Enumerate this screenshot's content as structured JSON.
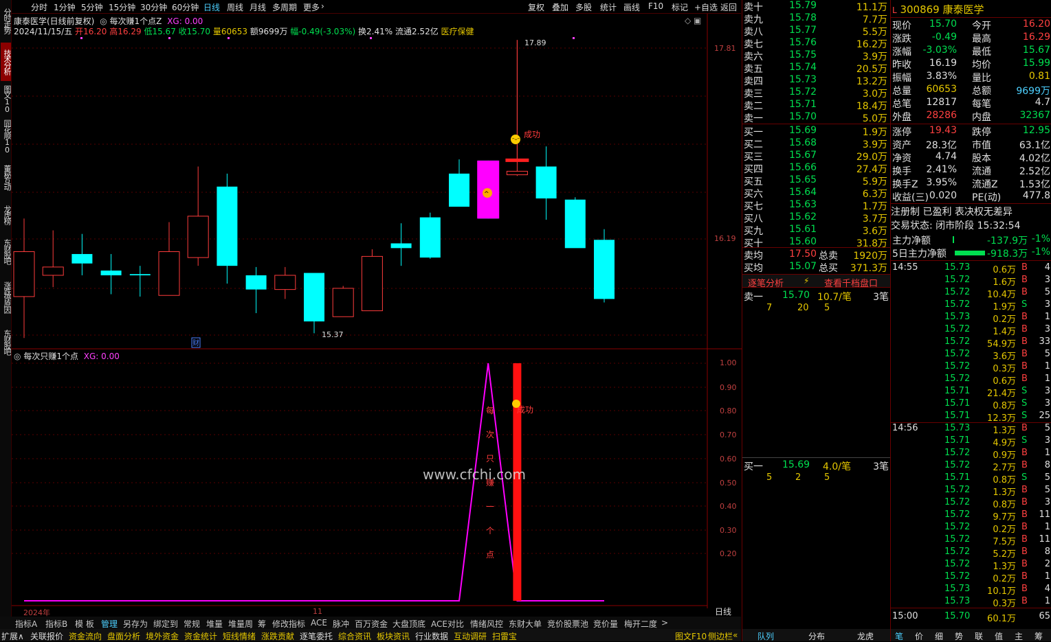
{
  "left_tabs": [
    "分时走势",
    "技术分析",
    "图文10",
    "同花顺10",
    "董秘互动",
    "龙虎榜",
    "东财股吧",
    "涨跌停原因",
    "东财股吧"
  ],
  "top_periods": [
    "分时",
    "1分钟",
    "5分钟",
    "15分钟",
    "30分钟",
    "60分钟",
    "日线",
    "周线",
    "月线",
    "多周期",
    "更多"
  ],
  "top_tools": [
    "复权",
    "叠加",
    "多股",
    "统计",
    "画线",
    "F10",
    "标记",
    "+自选",
    "返回"
  ],
  "chart_header": {
    "title": "康泰医学(日线前复权)",
    "indicator": "每次赚1个点Z",
    "xg": "XG: 0.00",
    "date": "2024/11/15/五",
    "open_l": "开",
    "open": "16.20",
    "high_l": "高",
    "high": "16.29",
    "low_l": "低",
    "low": "15.67",
    "close_l": "收",
    "close": "15.70",
    "vol_l": "量",
    "vol": "60653",
    "amt_l": "额",
    "amt": "9699万",
    "chg_l": "幅",
    "chg": "-0.49(-3.03%)",
    "turn_l": "换",
    "turn": "2.41%",
    "float_l": "流通",
    "float": "2.52亿",
    "sector": "医疗保健"
  },
  "main_chart": {
    "price_labels": [
      "17.81",
      "16.19"
    ],
    "high_marker": "17.89",
    "low_marker": "15.37",
    "success": "成功",
    "cai": "财"
  },
  "sub_header": {
    "name": "每次只赚1个点",
    "xg": "XG: 0.00"
  },
  "sub_axis": [
    "1.00",
    "0.90",
    "0.80",
    "0.70",
    "0.60",
    "0.50",
    "0.40",
    "0.30",
    "0.20"
  ],
  "sub_text": [
    "每",
    "次",
    "只",
    "赚",
    "一",
    "个",
    "点"
  ],
  "sub_success": "成功",
  "watermark": "www.cfchi.com",
  "x_labels": [
    "2024年",
    "11"
  ],
  "period_button": "日线",
  "zoom": [
    "+",
    "-",
    "◁",
    "▷"
  ],
  "chart_data": {
    "type": "candlestick",
    "ylim": [
      15.2,
      18.0
    ],
    "candles": [
      {
        "o": 15.72,
        "h": 16.38,
        "l": 15.37,
        "c": 16.1
      },
      {
        "o": 15.9,
        "h": 16.28,
        "l": 15.8,
        "c": 15.97
      },
      {
        "o": 16.08,
        "h": 16.25,
        "l": 15.9,
        "c": 16.0
      },
      {
        "o": 15.94,
        "h": 16.08,
        "l": 15.74,
        "c": 15.9
      },
      {
        "o": 15.91,
        "h": 15.98,
        "l": 15.72,
        "c": 15.9
      },
      {
        "o": 15.73,
        "h": 16.35,
        "l": 15.75,
        "c": 16.1
      },
      {
        "o": 16.05,
        "h": 16.82,
        "l": 15.98,
        "c": 16.4
      },
      {
        "o": 16.65,
        "h": 16.76,
        "l": 15.83,
        "c": 15.98
      },
      {
        "o": 15.9,
        "h": 15.97,
        "l": 15.58,
        "c": 15.78
      },
      {
        "o": 15.78,
        "h": 15.97,
        "l": 15.7,
        "c": 15.9
      },
      {
        "o": 15.92,
        "h": 15.92,
        "l": 15.41,
        "c": 15.51
      },
      {
        "o": 15.55,
        "h": 15.81,
        "l": 15.57,
        "c": 15.79
      },
      {
        "o": 15.6,
        "h": 16.12,
        "l": 15.64,
        "c": 16.06
      },
      {
        "o": 16.17,
        "h": 16.34,
        "l": 15.98,
        "c": 16.13
      },
      {
        "o": 16.39,
        "h": 16.43,
        "l": 16.04,
        "c": 16.05
      },
      {
        "o": 16.76,
        "h": 16.88,
        "l": 16.49,
        "c": 16.48
      },
      {
        "o": 16.87,
        "h": 16.87,
        "l": 16.38,
        "c": 16.38
      },
      {
        "o": 16.75,
        "h": 17.89,
        "l": 16.74,
        "c": 16.78
      },
      {
        "o": 16.82,
        "h": 16.99,
        "l": 16.37,
        "c": 16.55
      },
      {
        "o": 16.54,
        "h": 16.56,
        "l": 16.23,
        "c": 16.13
      },
      {
        "o": 16.2,
        "h": 16.29,
        "l": 15.67,
        "c": 15.7
      }
    ],
    "signal": [
      0,
      0,
      0,
      0,
      0,
      0,
      0,
      0,
      0,
      0,
      0,
      0,
      0,
      0,
      0,
      0,
      1,
      0,
      0,
      0,
      0
    ],
    "signal_bar_index": 17
  },
  "stock": {
    "flag": "L",
    "code": "300869",
    "name": "康泰医学"
  },
  "orderbook": {
    "asks": [
      {
        "label": "卖十",
        "price": "15.79",
        "vol": "11.1万"
      },
      {
        "label": "卖九",
        "price": "15.78",
        "vol": "7.7万"
      },
      {
        "label": "卖八",
        "price": "15.77",
        "vol": "5.5万"
      },
      {
        "label": "卖七",
        "price": "15.76",
        "vol": "16.2万"
      },
      {
        "label": "卖六",
        "price": "15.75",
        "vol": "3.9万"
      },
      {
        "label": "卖五",
        "price": "15.74",
        "vol": "20.5万"
      },
      {
        "label": "卖四",
        "price": "15.73",
        "vol": "13.2万"
      },
      {
        "label": "卖三",
        "price": "15.72",
        "vol": "3.0万"
      },
      {
        "label": "卖二",
        "price": "15.71",
        "vol": "18.4万"
      },
      {
        "label": "卖一",
        "price": "15.70",
        "vol": "5.0万"
      }
    ],
    "bids": [
      {
        "label": "买一",
        "price": "15.69",
        "vol": "1.9万"
      },
      {
        "label": "买二",
        "price": "15.68",
        "vol": "3.9万"
      },
      {
        "label": "买三",
        "price": "15.67",
        "vol": "29.0万"
      },
      {
        "label": "买四",
        "price": "15.66",
        "vol": "27.4万"
      },
      {
        "label": "买五",
        "price": "15.65",
        "vol": "5.9万"
      },
      {
        "label": "买六",
        "price": "15.64",
        "vol": "6.3万"
      },
      {
        "label": "买七",
        "price": "15.63",
        "vol": "1.7万"
      },
      {
        "label": "买八",
        "price": "15.62",
        "vol": "3.7万"
      },
      {
        "label": "买九",
        "price": "15.61",
        "vol": "3.6万"
      },
      {
        "label": "买十",
        "price": "15.60",
        "vol": "31.8万"
      }
    ],
    "ask_avg_l": "卖均",
    "ask_avg": "17.50",
    "total_ask_l": "总卖",
    "total_ask": "1920万",
    "bid_avg_l": "买均",
    "bid_avg": "15.07",
    "total_bid_l": "总买",
    "total_bid": "371.3万",
    "tab_a": "逐笔分析",
    "tab_b": "查看千档盘口",
    "s1": {
      "label": "卖一",
      "price": "15.70",
      "per": "10.7/笔",
      "cnt": "3笔",
      "q": [
        "7",
        "20",
        "5"
      ]
    },
    "b1": {
      "label": "买一",
      "price": "15.69",
      "per": "4.0/笔",
      "cnt": "3笔",
      "q": [
        "5",
        "2",
        "5"
      ]
    },
    "bottom_tabs": [
      "队列",
      "分布",
      "龙虎"
    ]
  },
  "quote": [
    [
      "现价",
      "15.70",
      "今开",
      "16.20"
    ],
    [
      "涨跌",
      "-0.49",
      "最高",
      "16.29"
    ],
    [
      "涨幅",
      "-3.03%",
      "最低",
      "15.67"
    ],
    [
      "昨收",
      "16.19",
      "均价",
      "15.99"
    ],
    [
      "振幅",
      "3.83%",
      "量比",
      "0.81"
    ],
    [
      "总量",
      "60653",
      "总额",
      "9699万"
    ],
    [
      "总笔",
      "12817",
      "每笔",
      "4.7"
    ],
    [
      "外盘",
      "28286",
      "内盘",
      "32367"
    ],
    [
      "涨停",
      "19.43",
      "跌停",
      "12.95"
    ],
    [
      "资产",
      "28.3亿",
      "市值",
      "63.1亿"
    ],
    [
      "净资",
      "4.74",
      "股本",
      "4.02亿"
    ],
    [
      "换手",
      "2.41%",
      "流通",
      "2.52亿"
    ],
    [
      "换手Z",
      "3.95%",
      "流通Z",
      "1.53亿"
    ],
    [
      "收益(三)",
      "0.020",
      "PE(动)",
      "477.8"
    ]
  ],
  "reg_info": "注册制 已盈利 表决权无差异",
  "trade_status": "交易状态: 闭市阶段 15:32:54",
  "main_flow": {
    "label": "主力净额",
    "value": "-137.9万",
    "pct": "-1%"
  },
  "main_flow5": {
    "label": "5日主力净额",
    "value": "-918.3万",
    "pct": "-1%"
  },
  "ticks": [
    {
      "t": "14:55",
      "p": "15.73",
      "v": "0.6万",
      "s": "B",
      "n": "4"
    },
    {
      "t": "",
      "p": "15.72",
      "v": "1.6万",
      "s": "B",
      "n": "3"
    },
    {
      "t": "",
      "p": "15.72",
      "v": "10.4万",
      "s": "B",
      "n": "5"
    },
    {
      "t": "",
      "p": "15.72",
      "v": "1.9万",
      "s": "S",
      "n": "3"
    },
    {
      "t": "",
      "p": "15.73",
      "v": "0.2万",
      "s": "B",
      "n": "1"
    },
    {
      "t": "",
      "p": "15.72",
      "v": "1.4万",
      "s": "B",
      "n": "3"
    },
    {
      "t": "",
      "p": "15.72",
      "v": "54.9万",
      "s": "B",
      "n": "33"
    },
    {
      "t": "",
      "p": "15.72",
      "v": "3.6万",
      "s": "B",
      "n": "5"
    },
    {
      "t": "",
      "p": "15.72",
      "v": "0.3万",
      "s": "B",
      "n": "1"
    },
    {
      "t": "",
      "p": "15.72",
      "v": "0.6万",
      "s": "B",
      "n": "1"
    },
    {
      "t": "",
      "p": "15.71",
      "v": "21.4万",
      "s": "S",
      "n": "3"
    },
    {
      "t": "",
      "p": "15.71",
      "v": "0.8万",
      "s": "S",
      "n": "3"
    },
    {
      "t": "",
      "p": "15.71",
      "v": "12.3万",
      "s": "S",
      "n": "25"
    },
    {
      "t": "14:56",
      "p": "15.73",
      "v": "1.3万",
      "s": "B",
      "n": "5"
    },
    {
      "t": "",
      "p": "15.71",
      "v": "4.9万",
      "s": "S",
      "n": "3"
    },
    {
      "t": "",
      "p": "15.72",
      "v": "0.9万",
      "s": "B",
      "n": "1"
    },
    {
      "t": "",
      "p": "15.72",
      "v": "2.7万",
      "s": "B",
      "n": "8"
    },
    {
      "t": "",
      "p": "15.71",
      "v": "0.8万",
      "s": "S",
      "n": "5"
    },
    {
      "t": "",
      "p": "15.72",
      "v": "1.3万",
      "s": "B",
      "n": "5"
    },
    {
      "t": "",
      "p": "15.72",
      "v": "0.8万",
      "s": "B",
      "n": "3"
    },
    {
      "t": "",
      "p": "15.72",
      "v": "9.7万",
      "s": "B",
      "n": "11"
    },
    {
      "t": "",
      "p": "15.72",
      "v": "0.2万",
      "s": "B",
      "n": "1"
    },
    {
      "t": "",
      "p": "15.72",
      "v": "7.5万",
      "s": "B",
      "n": "11"
    },
    {
      "t": "",
      "p": "15.72",
      "v": "5.2万",
      "s": "B",
      "n": "8"
    },
    {
      "t": "",
      "p": "15.72",
      "v": "1.3万",
      "s": "B",
      "n": "2"
    },
    {
      "t": "",
      "p": "15.72",
      "v": "0.2万",
      "s": "B",
      "n": "1"
    },
    {
      "t": "",
      "p": "15.73",
      "v": "10.1万",
      "s": "B",
      "n": "4"
    },
    {
      "t": "",
      "p": "15.73",
      "v": "0.3万",
      "s": "B",
      "n": "1"
    },
    {
      "t": "15:00",
      "p": "15.70",
      "v": "60.1万",
      "s": "",
      "n": "65"
    }
  ],
  "right_bottom_tabs": [
    "笔",
    "价",
    "细",
    "势",
    "联",
    "值",
    "主",
    "筹"
  ],
  "bottom_bar1": [
    "指标A",
    "指标B",
    "模 板",
    "管理",
    "另存为",
    "绑定到",
    "常规",
    "堆量",
    "堆量周",
    "筹",
    "修改指标",
    "ACE",
    "脉冲",
    "百万资金",
    "大盘顶底",
    "ACE对比",
    "情绪风控",
    "东财大单",
    "竞价股票池",
    "竞价量",
    "梅开二度",
    ">"
  ],
  "bottom_bar2": [
    "扩展∧",
    "关联报价",
    "资金流向",
    "盘面分析",
    "境外资金",
    "资金统计",
    "短线情绪",
    "涨跌贡献",
    "逐笔委托",
    "综合资讯",
    "板块资讯",
    "行业数据",
    "互动调研",
    "扫雷宝"
  ],
  "bottom_bar2_right": [
    "图文F10",
    "侧边栏",
    "«"
  ],
  "colors": {
    "up": "#ff3c3c",
    "down": "#00ffff",
    "signal": "#ff00ff",
    "bg": "#000000"
  }
}
